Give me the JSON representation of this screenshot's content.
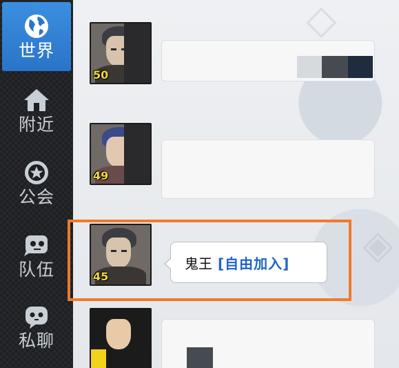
{
  "sidebar": {
    "items": [
      {
        "label": "世界",
        "icon": "globe-icon",
        "active": true
      },
      {
        "label": "附近",
        "icon": "house-icon",
        "active": false
      },
      {
        "label": "公会",
        "icon": "guild-emblem-icon",
        "active": false
      },
      {
        "label": "队伍",
        "icon": "team-face-icon",
        "active": false
      },
      {
        "label": "私聊",
        "icon": "chat-face-icon",
        "active": false
      }
    ]
  },
  "chat": {
    "messages": [
      {
        "level": "50"
      },
      {
        "level": "49"
      },
      {
        "level": "45",
        "sender": "鬼王",
        "link_text": "[自由加入]"
      },
      {
        "level": ""
      }
    ]
  },
  "colors": {
    "active_tab": "#2a74c8",
    "highlight": "#f07a2c",
    "link": "#1f63c9",
    "level": "#f3d93a"
  }
}
